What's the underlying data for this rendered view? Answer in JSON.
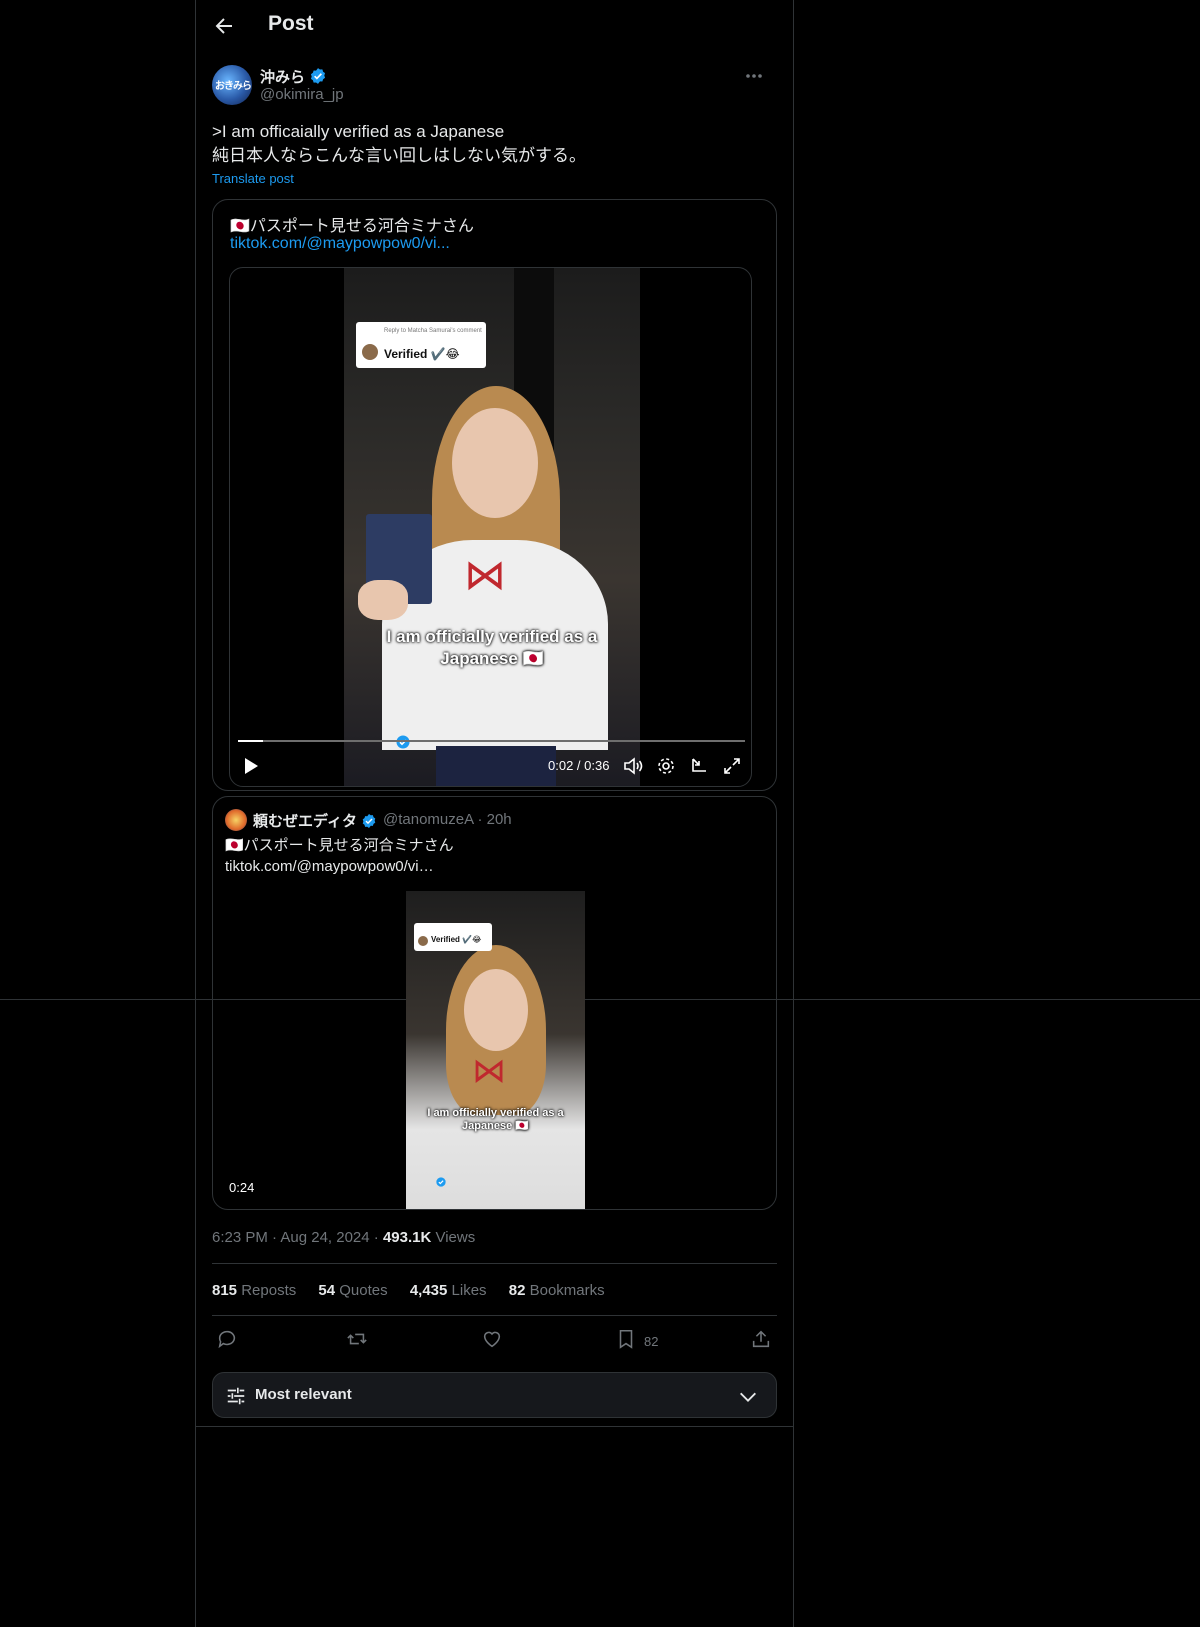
{
  "header": {
    "title": "Post"
  },
  "post": {
    "author_name": "沖みら",
    "author_handle": "@okimira_jp",
    "avatar_text": "おきみら",
    "text": ">I am officaially verified as a Japanese\n純日本人ならこんな言い回しはしない気がする。",
    "translate_label": "Translate post",
    "timestamp": "6:23 PM · Aug 24, 2024 · ",
    "views_count": "493.1K",
    "views_label": " Views"
  },
  "card": {
    "title": "🇯🇵パスポート見せる河合ミナさん",
    "link": "tiktok.com/@maypowpow0/vi...",
    "video": {
      "bubble_small": "Reply to Matcha Samurai's comment",
      "bubble_main": "Verified ✔️😂",
      "caption_line1": "I am officially verified as a",
      "caption_line2": "Japanese 🇯🇵",
      "time": "0:02 / 0:36",
      "progress": 0.05
    }
  },
  "quoted": {
    "name": "頼むぜエディタ",
    "handle": "@tanomuzeA · 20h",
    "text": "🇯🇵パスポート見せる河合ミナさん\ntiktok.com/@maypowpow0/vi…",
    "bubble_main": "Verified ✔️😂",
    "caption_line1": "I am officially verified as a",
    "caption_line2": "Japanese 🇯🇵",
    "duration": "0:24"
  },
  "stats": {
    "reposts_count": "815",
    "reposts_label": "Reposts",
    "quotes_count": "54",
    "quotes_label": "Quotes",
    "likes_count": "4,435",
    "likes_label": "Likes",
    "bookmarks_count": "82",
    "bookmarks_label": "Bookmarks"
  },
  "actions": {
    "bookmark_count": "82"
  },
  "sort": {
    "label": "Most relevant"
  },
  "colors": {
    "accent": "#1d9bf0",
    "background": "#000000",
    "border": "#2f3336",
    "muted": "#71767b",
    "text": "#e7e9ea"
  }
}
